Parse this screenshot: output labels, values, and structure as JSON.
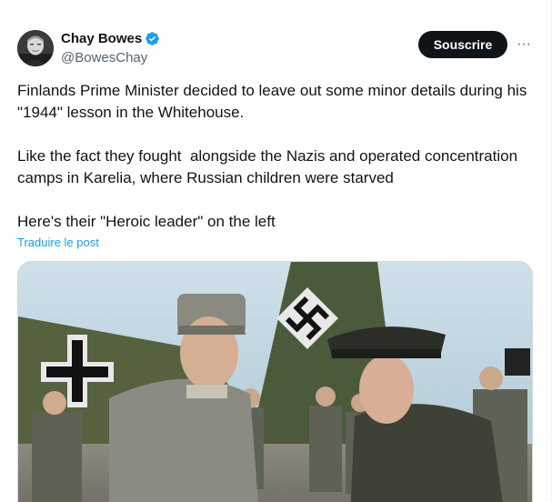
{
  "tweet": {
    "author": {
      "name": "Chay Bowes",
      "handle": "@BowesChay",
      "verified": true,
      "avatar_icon": "profile-photo"
    },
    "subscribe_label": "Souscrire",
    "more_icon": "more-dots-icon",
    "more_glyph": "···",
    "text": {
      "paragraph1": "Finlands Prime Minister decided to leave out some minor details during his \"1944\" lesson in the Whitehouse.",
      "paragraph2": "Like the fact they fought  alongside the Nazis and operated concentration camps in Karelia, where Russian children were starved",
      "paragraph3": "Here's their \"Heroic leader\" on the left"
    },
    "translate_label": "Traduire le post",
    "media": {
      "type": "photo",
      "icon": "photo"
    }
  },
  "colors": {
    "text": "#0f1419",
    "secondary": "#536471",
    "link": "#1d9bf0",
    "verified": "#1d9bf0",
    "button_bg": "#0f1419"
  }
}
